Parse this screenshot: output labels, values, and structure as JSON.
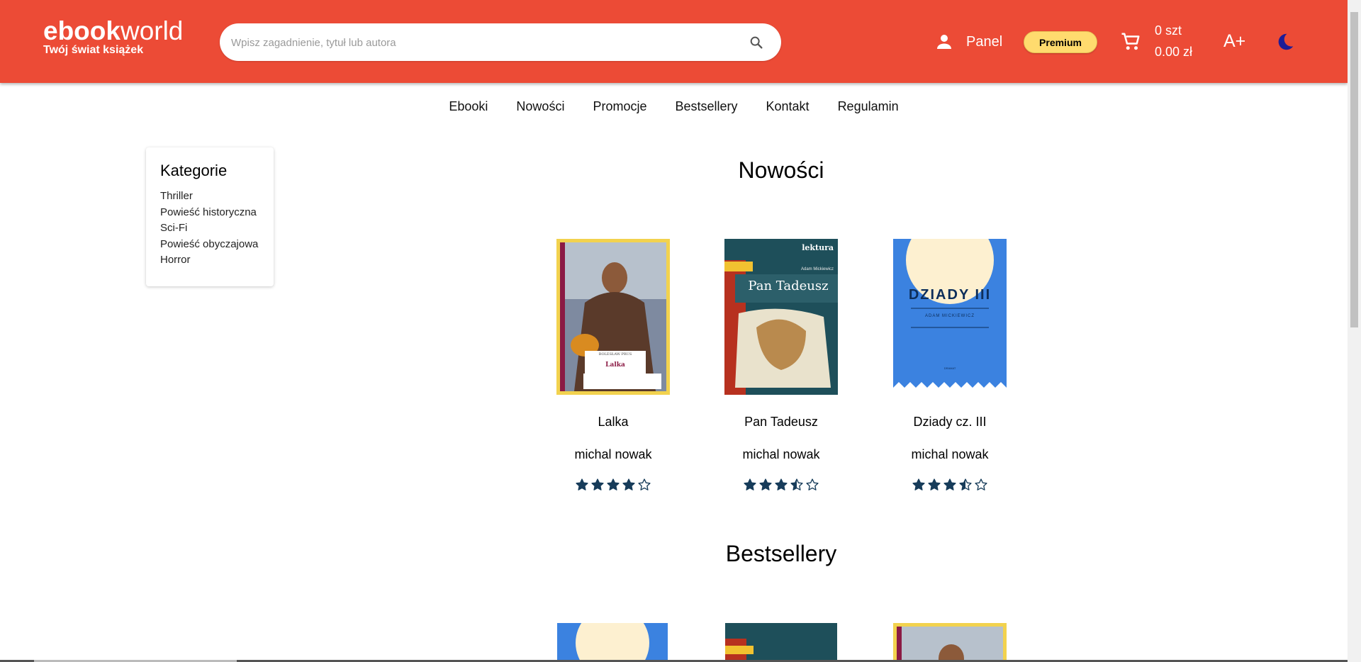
{
  "header": {
    "logo_bold": "ebook",
    "logo_light": "world",
    "tagline": "Twój świat książek",
    "search_placeholder": "Wpisz zagadnienie, tytuł lub autora",
    "panel_label": "Panel",
    "premium_label": "Premium",
    "cart_qty": "0 szt",
    "cart_total": "0.00 zł",
    "font_size_label": "A+",
    "icons": [
      "user-icon",
      "search-icon",
      "cart-icon",
      "moon-icon"
    ]
  },
  "nav": [
    "Ebooki",
    "Nowości",
    "Promocje",
    "Bestsellery",
    "Kontakt",
    "Regulamin"
  ],
  "sidebar": {
    "title": "Kategorie",
    "items": [
      "Thriller",
      "Powieść historyczna",
      "Sci-Fi",
      "Powieść obyczajowa",
      "Horror"
    ]
  },
  "sections": {
    "new": {
      "title": "Nowości",
      "books": [
        {
          "title": "Lalka",
          "author": "michal nowak",
          "rating": 4,
          "cover_title": "Lalka",
          "cover_author": "BOLESŁAW PRUS"
        },
        {
          "title": "Pan Tadeusz",
          "author": "michal nowak",
          "rating": 3.5,
          "cover_title": "Pan Tadeusz",
          "cover_author": "Adam Mickiewicz",
          "cover_series": "lektura"
        },
        {
          "title": "Dziady cz. III",
          "author": "michal nowak",
          "rating": 3.5,
          "cover_title": "DZIADY III",
          "cover_author": "ADAM MICKIEWICZ",
          "cover_genre": "DRAMAT"
        }
      ]
    },
    "bestsellers": {
      "title": "Bestsellery"
    }
  },
  "colors": {
    "brand": "#EC4B36",
    "premium": "#FFDB6E",
    "star": "#173C5A",
    "moon": "#1E1C96"
  }
}
